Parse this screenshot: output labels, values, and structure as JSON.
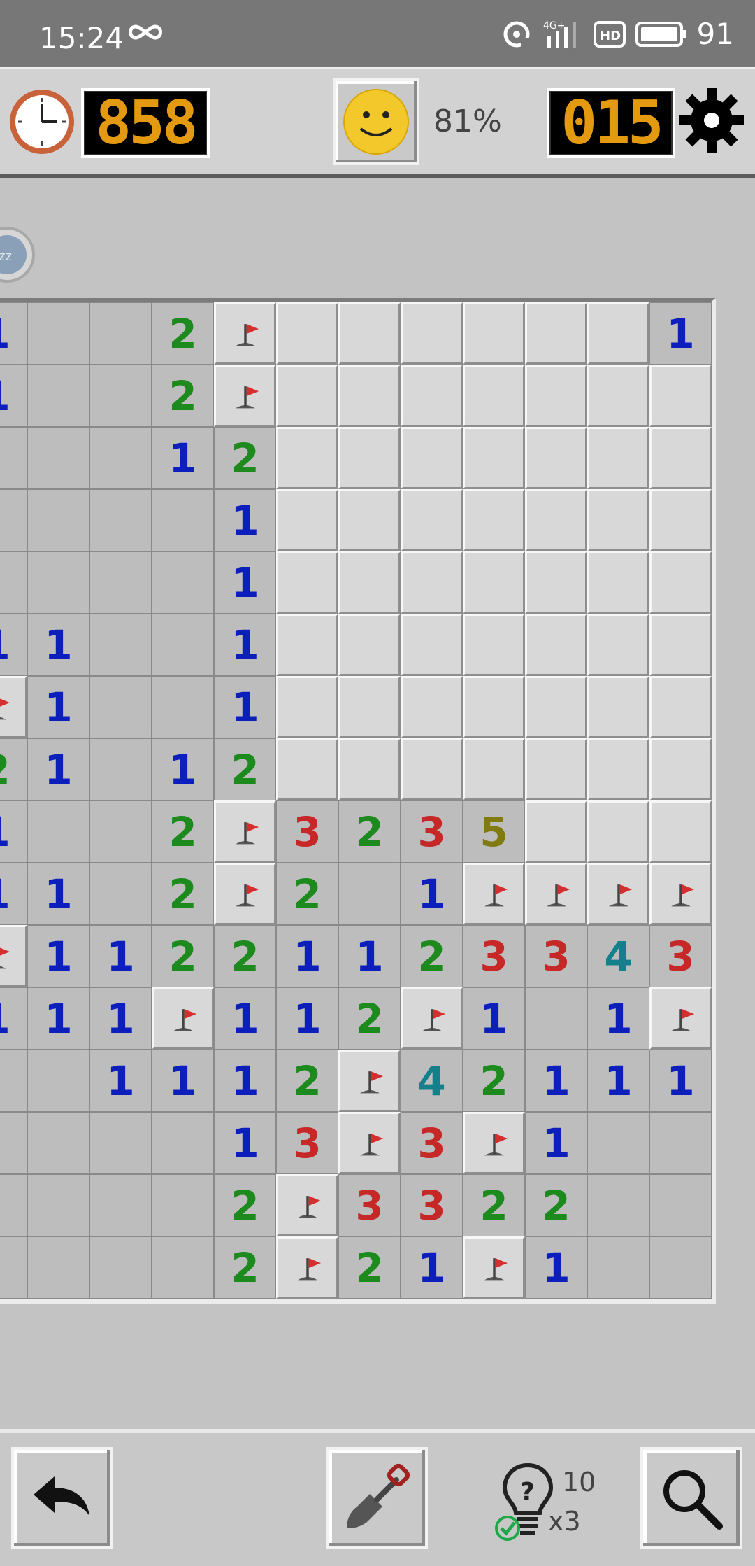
{
  "status_bar": {
    "time": "15:24",
    "network": "4G+",
    "hd": "HD",
    "battery": "91"
  },
  "header": {
    "timer": "858",
    "progress": "81%",
    "mines_left": "015"
  },
  "board": {
    "legend": {
      "F": "flag",
      "C": "covered",
      ".": "revealed-empty",
      "1-5": "revealed-number"
    },
    "rows": [
      "1..2FCCCCCC1",
      "1..2FCCCCCCC",
      "...12CCCCCCC",
      "....1CCCCCCC",
      "....1CCCCCCC",
      "11..1CCCCCCC",
      "F1..1CCCCCCC",
      "21.12CCCCCCC",
      "1..2F3235CCC",
      "11.2F2.1FFFF",
      "F112211233433",
      "111F112F1.1F",
      "..1112F42111",
      "....13F3F1..",
      "....2F3322..",
      "....2F21F1.."
    ]
  },
  "toolbar": {
    "hint_count": "10",
    "hint_multiplier": "x3"
  },
  "colors": {
    "n1": "#0c1fbd",
    "n2": "#1c8a1c",
    "n3": "#c62828",
    "n4": "#13808c",
    "n5": "#807a10",
    "lcd": "#e39a10"
  }
}
